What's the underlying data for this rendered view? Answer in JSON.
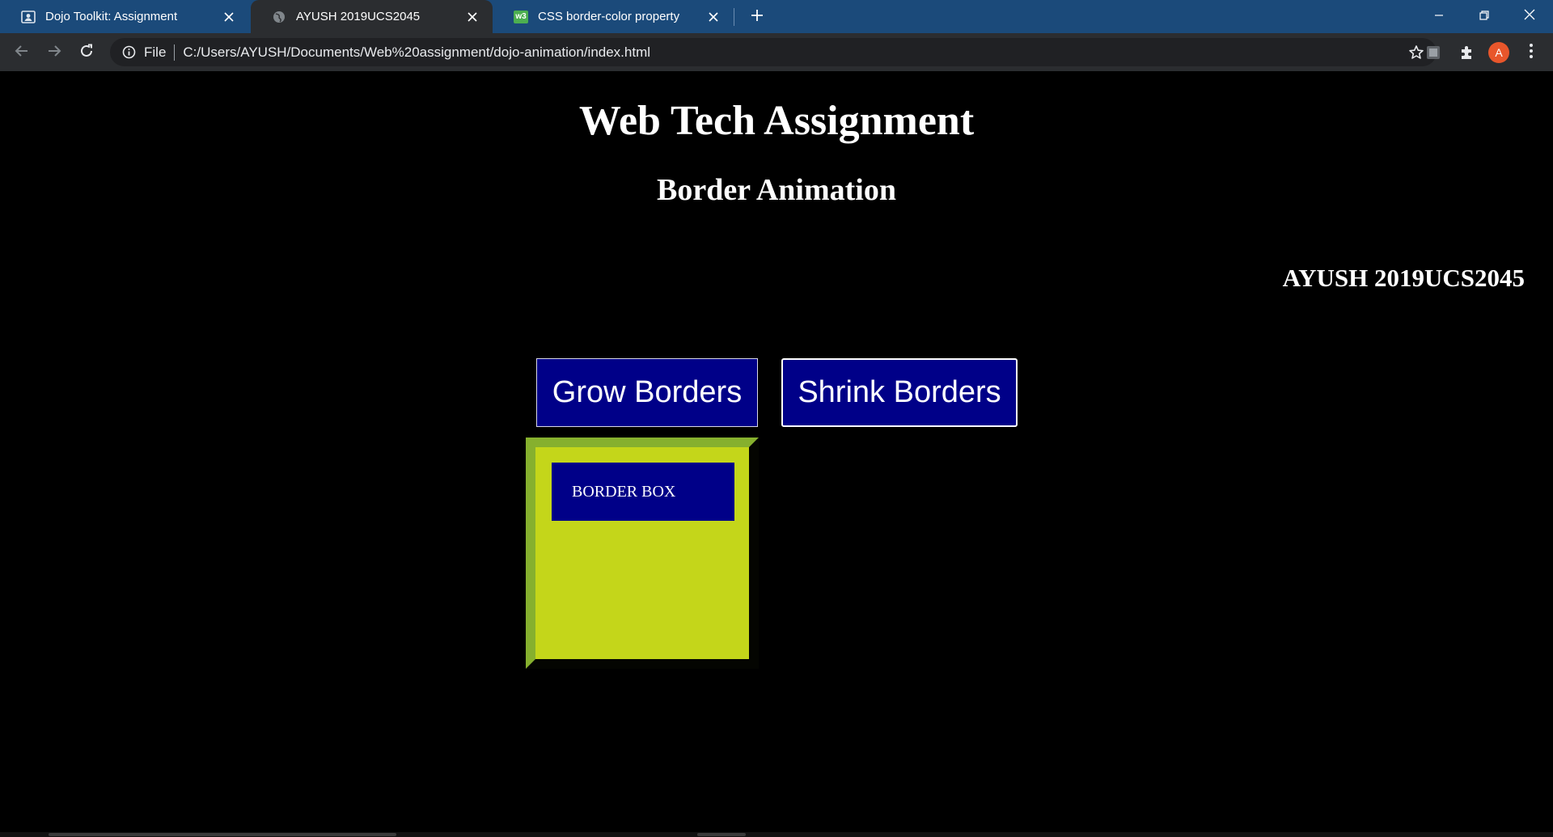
{
  "browser": {
    "tabs": [
      {
        "label": "Dojo Toolkit: Assignment",
        "icon": "tab-page-icon",
        "active": false
      },
      {
        "label": "AYUSH 2019UCS2045",
        "icon": "globe-icon",
        "active": true
      },
      {
        "label": "CSS border-color property",
        "icon": "w3-icon",
        "active": false
      }
    ],
    "favicon_text": "w3",
    "protocol": "File",
    "url": "C:/Users/AYUSH/Documents/Web%20assignment/dojo-animation/index.html",
    "avatar_letter": "A"
  },
  "page": {
    "heading": "Web Tech Assignment",
    "subheading": "Border Animation",
    "author": "AYUSH 2019UCS2045",
    "grow_button": "Grow Borders",
    "shrink_button": "Shrink Borders",
    "box_label": "BORDER BOX"
  },
  "colors": {
    "tabstrip": "#1b4a7a",
    "toolbar": "#2b2d30",
    "page_background": "#000000",
    "button_background": "#000088",
    "box_fill": "#c4d61a",
    "box_border": "#86b02e"
  }
}
